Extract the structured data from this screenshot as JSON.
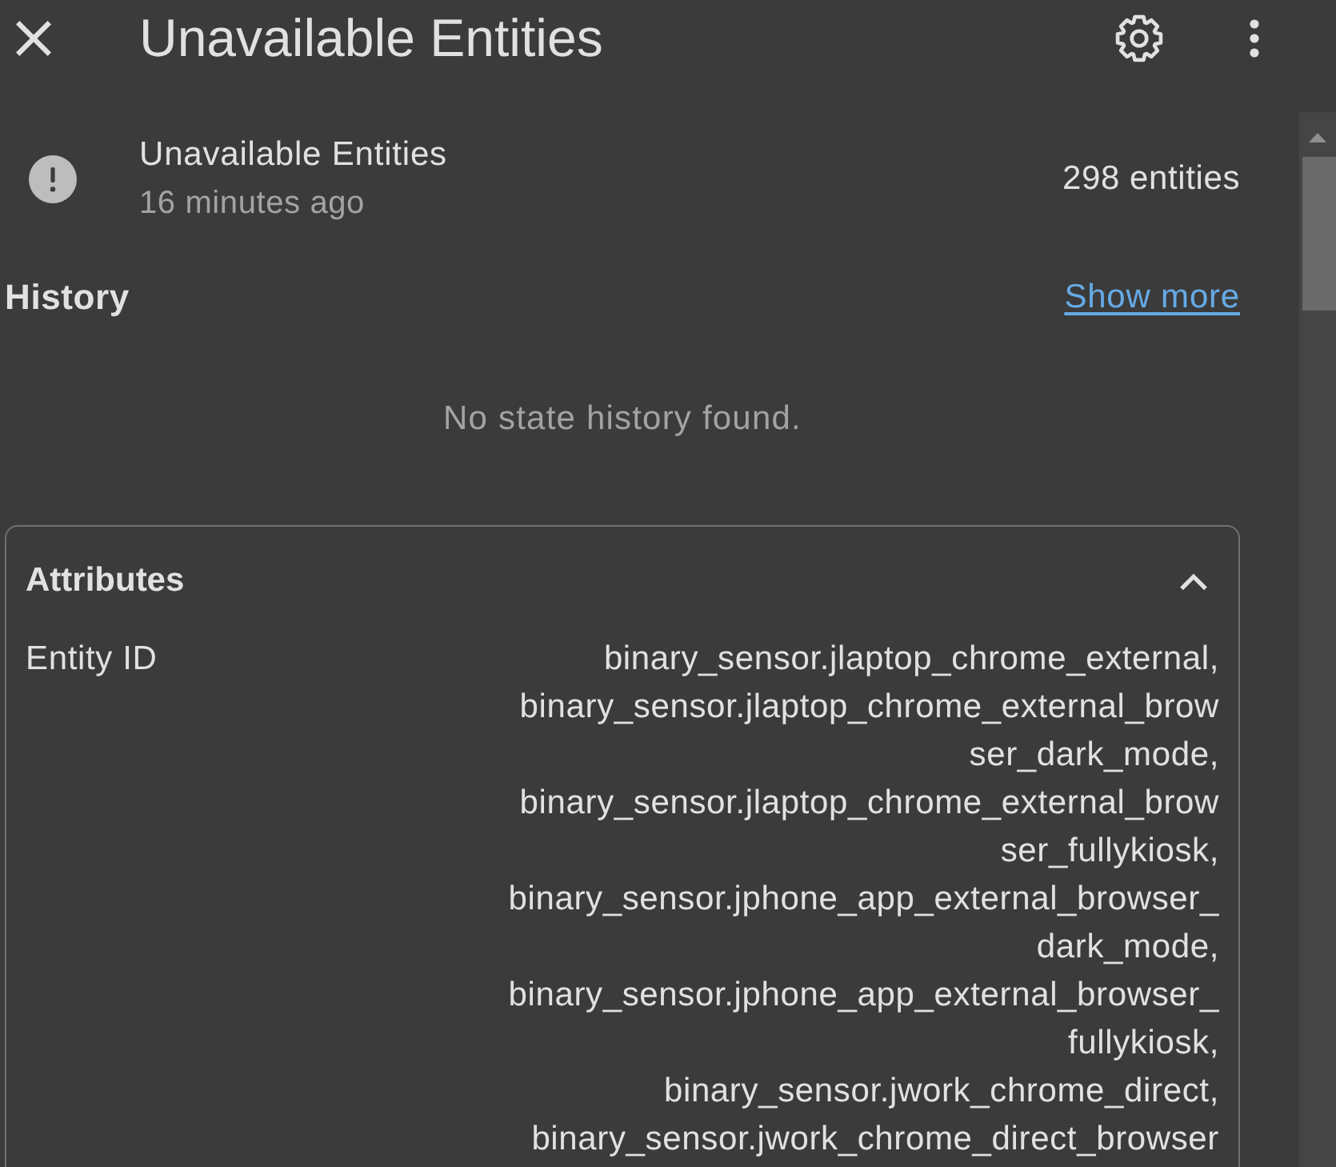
{
  "dialog": {
    "title": "Unavailable Entities"
  },
  "entity": {
    "name": "Unavailable Entities",
    "last_changed": "16 minutes ago",
    "state": "298 entities"
  },
  "history": {
    "title": "History",
    "link": "Show more",
    "empty_message": "No state history found."
  },
  "attributes": {
    "title": "Attributes",
    "expanded": true,
    "rows": [
      {
        "label": "Entity ID",
        "values": [
          "binary_sensor.jlaptop_chrome_external,",
          "binary_sensor.jlaptop_chrome_external_browser_dark_mode,",
          "binary_sensor.jlaptop_chrome_external_browser_fullykiosk,",
          "binary_sensor.jphone_app_external_browser_dark_mode,",
          "binary_sensor.jphone_app_external_browser_fullykiosk,",
          "binary_sensor.jwork_chrome_direct,",
          "binary_sensor.jwork_chrome_direct_browser"
        ]
      }
    ]
  }
}
